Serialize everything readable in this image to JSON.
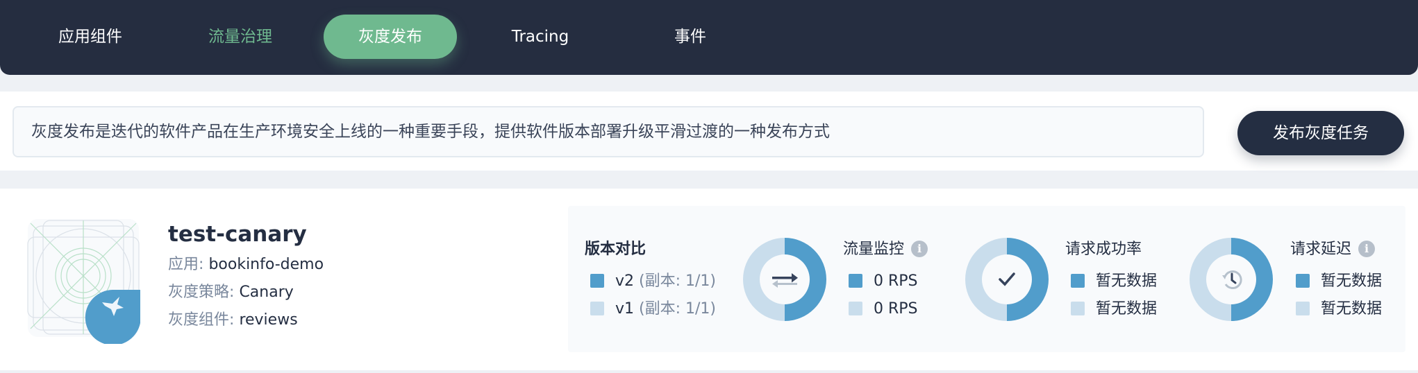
{
  "colors": {
    "nav_bg": "#252d40",
    "accent_green": "#6fb98f",
    "primary_blue": "#519dcb",
    "light_blue": "#c9ddec",
    "dark": "#242e42",
    "muted": "#79879c"
  },
  "nav": {
    "tabs": [
      {
        "label": "应用组件",
        "state": "normal"
      },
      {
        "label": "流量治理",
        "state": "highlight"
      },
      {
        "label": "灰度发布",
        "state": "active"
      },
      {
        "label": "Tracing",
        "state": "normal"
      },
      {
        "label": "事件",
        "state": "normal"
      }
    ]
  },
  "banner": {
    "description": "灰度发布是迭代的软件产品在生产环境安全上线的一种重要手段，提供软件版本部署升级平滑过渡的一种发布方式",
    "publish_button": "发布灰度任务"
  },
  "job": {
    "name": "test-canary",
    "icon": "bird-icon",
    "fields": [
      {
        "label": "应用",
        "value": "bookinfo-demo"
      },
      {
        "label": "灰度策略",
        "value": "Canary"
      },
      {
        "label": "灰度组件",
        "value": "reviews"
      }
    ],
    "stats": {
      "version_compare": {
        "title": "版本对比",
        "items": [
          {
            "version": "v2",
            "detail": "(副本: 1/1)",
            "color": "#519dcb"
          },
          {
            "version": "v1",
            "detail": "(副本: 1/1)",
            "color": "#c9ddec"
          }
        ],
        "split": [
          0.5,
          0.5
        ],
        "center_icon": "swap-arrows-icon"
      },
      "traffic": {
        "title": "流量监控",
        "has_info": true,
        "items": [
          "0 RPS",
          "0 RPS"
        ],
        "split": [
          0.5,
          0.5
        ],
        "center_icon": "check-icon"
      },
      "success_rate": {
        "title": "请求成功率",
        "has_info": false,
        "items": [
          "暂无数据",
          "暂无数据"
        ],
        "split": [
          0.5,
          0.5
        ],
        "center_icon": "clock-history-icon"
      },
      "latency": {
        "title": "请求延迟",
        "has_info": true,
        "items": [
          "暂无数据",
          "暂无数据"
        ]
      }
    },
    "info_glyph": "i"
  }
}
